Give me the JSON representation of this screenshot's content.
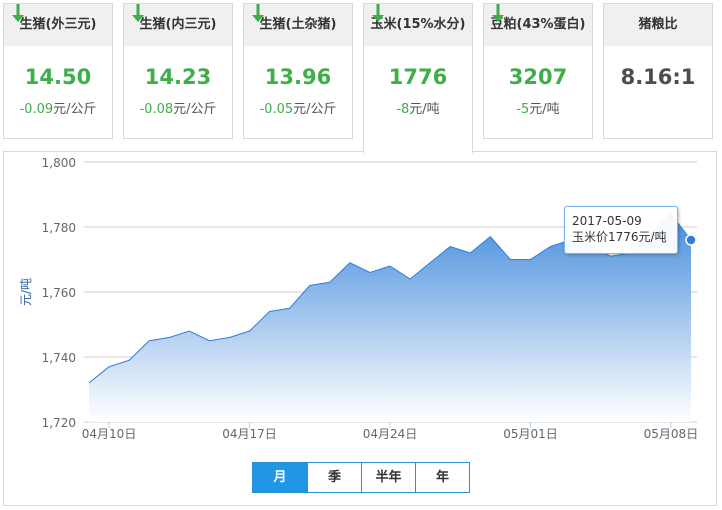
{
  "cards": [
    {
      "title": "生猪(外三元)",
      "price": "14.50",
      "change": "-0.09",
      "unit": "元/公斤",
      "trend": "down"
    },
    {
      "title": "生猪(内三元)",
      "price": "14.23",
      "change": "-0.08",
      "unit": "元/公斤",
      "trend": "down"
    },
    {
      "title": "生猪(土杂猪)",
      "price": "13.96",
      "change": "-0.05",
      "unit": "元/公斤",
      "trend": "down"
    },
    {
      "title": "玉米(15%水分)",
      "price": "1776",
      "change": "-8",
      "unit": "元/吨",
      "trend": "down",
      "active": true
    },
    {
      "title": "豆粕(43%蛋白)",
      "price": "3207",
      "change": "-5",
      "unit": "元/吨",
      "trend": "down"
    },
    {
      "title": "猪粮比",
      "price": "8.16:1",
      "change": "",
      "unit": "",
      "trend": "none"
    }
  ],
  "colors": {
    "down": "#3fae49",
    "series": "#2f7ed8",
    "accent": "#2196e4"
  },
  "chart_data": {
    "type": "area",
    "ylabel": "元/吨",
    "ylim": [
      1720,
      1800
    ],
    "yticks": [
      "1,720",
      "1,740",
      "1,760",
      "1,780",
      "1,800"
    ],
    "xticks": [
      "04月10日",
      "04月17日",
      "04月24日",
      "05月01日",
      "05月08日"
    ],
    "x": [
      "2017-04-09",
      "2017-04-10",
      "2017-04-11",
      "2017-04-12",
      "2017-04-13",
      "2017-04-14",
      "2017-04-15",
      "2017-04-16",
      "2017-04-17",
      "2017-04-18",
      "2017-04-19",
      "2017-04-20",
      "2017-04-21",
      "2017-04-22",
      "2017-04-23",
      "2017-04-24",
      "2017-04-25",
      "2017-04-26",
      "2017-04-27",
      "2017-04-28",
      "2017-04-29",
      "2017-04-30",
      "2017-05-01",
      "2017-05-02",
      "2017-05-03",
      "2017-05-04",
      "2017-05-05",
      "2017-05-06",
      "2017-05-07",
      "2017-05-08",
      "2017-05-09"
    ],
    "values": [
      1732,
      1737,
      1739,
      1745,
      1746,
      1748,
      1745,
      1746,
      1748,
      1754,
      1755,
      1762,
      1763,
      1769,
      1766,
      1768,
      1764,
      1769,
      1774,
      1772,
      1777,
      1770,
      1770,
      1774,
      1776,
      1774,
      1771,
      1772,
      1778,
      1784,
      1776
    ],
    "grid": true,
    "tooltip": {
      "date": "2017-05-09",
      "label": "玉米价1776元/吨"
    }
  },
  "range_buttons": [
    {
      "label": "月",
      "active": true
    },
    {
      "label": "季"
    },
    {
      "label": "半年"
    },
    {
      "label": "年"
    }
  ]
}
